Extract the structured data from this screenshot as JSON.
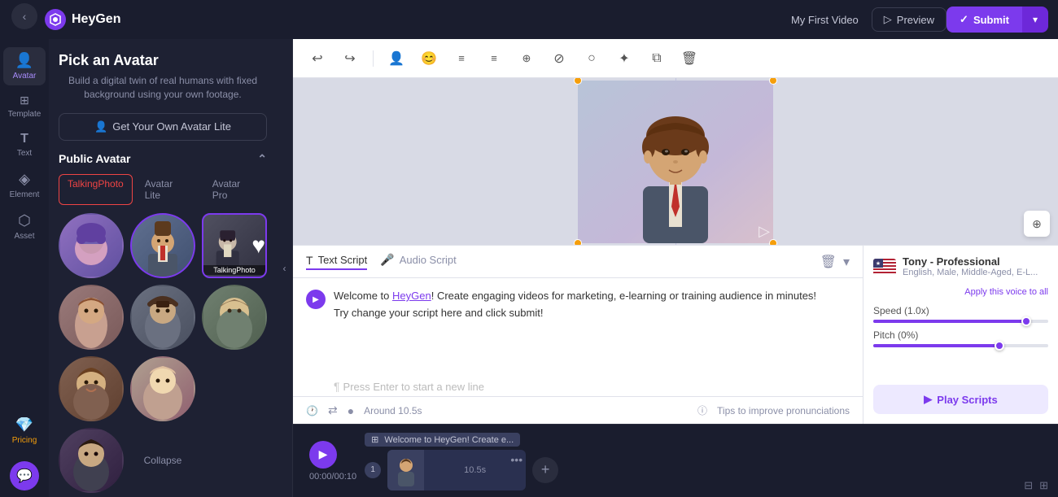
{
  "topbar": {
    "logo": "HeyGen",
    "video_title": "My First Video",
    "preview_label": "Preview",
    "submit_label": "Submit"
  },
  "sidebar": {
    "items": [
      {
        "id": "template",
        "label": "Template",
        "icon": "⊞"
      },
      {
        "id": "avatar",
        "label": "Avatar",
        "icon": "👤",
        "active": true
      },
      {
        "id": "text",
        "label": "Text",
        "icon": "T"
      },
      {
        "id": "element",
        "label": "Element",
        "icon": "◈"
      },
      {
        "id": "asset",
        "label": "Asset",
        "icon": "⬡"
      }
    ],
    "bottom": [
      {
        "id": "pricing",
        "label": "Pricing",
        "icon": "💎"
      }
    ]
  },
  "avatar_panel": {
    "title": "Pick an Avatar",
    "subtitle": "Build a digital twin of real humans with fixed background using your own footage.",
    "get_own_btn": "Get Your Own Avatar Lite",
    "section_title": "Public Avatar",
    "tabs": [
      {
        "id": "talking-photo",
        "label": "TalkingPhoto",
        "active": true
      },
      {
        "id": "avatar-lite",
        "label": "Avatar Lite"
      },
      {
        "id": "avatar-pro",
        "label": "Avatar Pro"
      }
    ],
    "avatars": [
      {
        "id": "av1",
        "type": "circle",
        "emoji": "🧝",
        "color": "#8060a0",
        "selected": false
      },
      {
        "id": "av2",
        "type": "circle",
        "emoji": "🧑",
        "color": "#607090",
        "selected": true
      },
      {
        "id": "av3",
        "type": "square",
        "emoji": "🧑",
        "color": "#404050",
        "label": "TalkingPhoto",
        "selected": true,
        "heart": true
      },
      {
        "id": "av4",
        "type": "circle",
        "emoji": "👩",
        "color": "#8a6a6a"
      },
      {
        "id": "av5",
        "type": "circle",
        "emoji": "🧔",
        "color": "#6a7080"
      },
      {
        "id": "av6",
        "type": "circle",
        "emoji": "🧓",
        "color": "#708070"
      },
      {
        "id": "av7",
        "type": "circle",
        "emoji": "🎨",
        "color": "#706050"
      },
      {
        "id": "av8",
        "type": "circle",
        "emoji": "🧔",
        "color": "#705060"
      },
      {
        "id": "av9",
        "type": "circle",
        "emoji": "👱",
        "color": "#606080"
      },
      {
        "id": "av10",
        "type": "circle",
        "emoji": "🧑",
        "color": "#504060"
      }
    ],
    "collapse_label": "Collapse"
  },
  "toolbar": {
    "buttons": [
      "↩",
      "↪",
      "👤",
      "😊",
      "≡≡",
      "≡⃞",
      "⊕",
      "⊘",
      "◯",
      "✦",
      "⧉",
      "🗑"
    ]
  },
  "script_panel": {
    "tabs": [
      {
        "id": "text-script",
        "label": "Text Script",
        "active": true
      },
      {
        "id": "audio-script",
        "label": "Audio Script"
      }
    ],
    "script_text_prefix": "Welcome to ",
    "script_link": "HeyGen",
    "script_text_suffix": "! Create engaging videos for marketing, e-learning or training audience in minutes!",
    "script_line2": "Try change your script here and click submit!",
    "placeholder": "Press Enter to start a new line",
    "timing": "Around 10.5s",
    "tips": "Tips to improve pronunciations",
    "apply_voice": "Apply this voice to all"
  },
  "voice_panel": {
    "name": "Tony - Professional",
    "description": "English, Male, Middle-Aged, E-L...",
    "speed_label": "Speed (1.0x)",
    "speed_value": 90,
    "pitch_label": "Pitch (0%)",
    "pitch_value": 75,
    "play_scripts": "Play Scripts"
  },
  "timeline": {
    "time": "00:00/00:10",
    "clip_label": "Welcome to HeyGen! Create e...",
    "clip_duration": "10.5s",
    "scene_number": "1"
  }
}
